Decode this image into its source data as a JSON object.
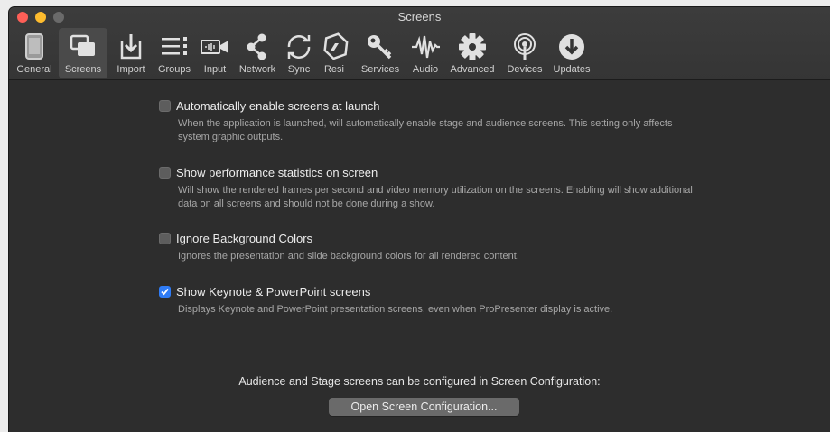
{
  "window": {
    "title": "Screens"
  },
  "toolbar": {
    "items": [
      {
        "label": "General",
        "icon": "tablet-icon"
      },
      {
        "label": "Screens",
        "icon": "screens-icon",
        "selected": true
      },
      {
        "label": "Import",
        "icon": "import-icon"
      },
      {
        "label": "Groups",
        "icon": "groups-icon"
      },
      {
        "label": "Input",
        "icon": "input-icon"
      },
      {
        "label": "Network",
        "icon": "network-icon"
      },
      {
        "label": "Sync",
        "icon": "sync-icon"
      },
      {
        "label": "Resi",
        "icon": "resi-icon"
      },
      {
        "label": "Services",
        "icon": "services-icon"
      },
      {
        "label": "Audio",
        "icon": "audio-icon"
      },
      {
        "label": "Advanced",
        "icon": "gear-icon"
      },
      {
        "label": "Devices",
        "icon": "devices-icon"
      },
      {
        "label": "Updates",
        "icon": "updates-icon"
      }
    ]
  },
  "options": [
    {
      "label": "Automatically enable screens at launch",
      "checked": false,
      "desc": "When the application is launched, will automatically enable stage and audience screens. This setting only affects system graphic outputs."
    },
    {
      "label": "Show performance statistics on screen",
      "checked": false,
      "desc": "Will show the rendered frames per second and video memory utilization on the screens. Enabling will show additional data on all screens and should not be done during a show."
    },
    {
      "label": "Ignore Background Colors",
      "checked": false,
      "desc": "Ignores the presentation and slide background colors for all rendered content."
    },
    {
      "label": "Show Keynote & PowerPoint screens",
      "checked": true,
      "desc": "Displays Keynote and PowerPoint presentation screens, even when ProPresenter display is active."
    }
  ],
  "footer": {
    "text": "Audience and Stage screens can be configured in Screen Configuration:",
    "button": "Open Screen Configuration..."
  },
  "colors": {
    "accent": "#2f7cf6",
    "background": "#2d2d2d"
  }
}
